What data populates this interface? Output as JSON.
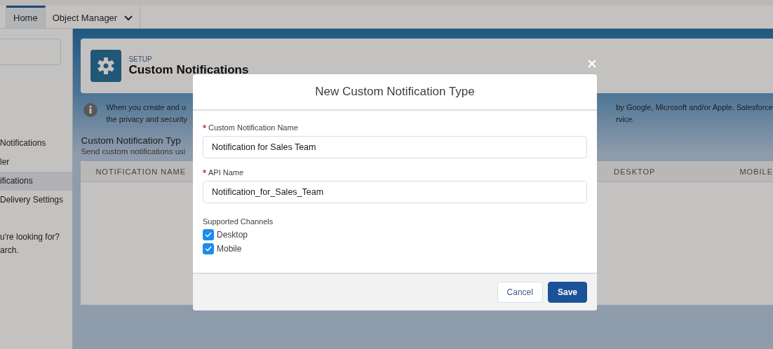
{
  "tabs": [
    {
      "label": "Home",
      "selected": true,
      "dropdown": false
    },
    {
      "label": "Object Manager",
      "selected": false,
      "dropdown": true
    }
  ],
  "sidebar": {
    "items": [
      {
        "label": "Notifications",
        "selected": false
      },
      {
        "label": "ler",
        "selected": false
      },
      {
        "label": "ifications",
        "selected": true
      },
      {
        "label": "Delivery Settings",
        "selected": false
      }
    ],
    "help_lines": [
      "u're looking for?",
      "arch."
    ]
  },
  "header": {
    "eyebrow": "SETUP",
    "title": "Custom Notifications"
  },
  "info": {
    "left_lines": [
      "When you create and u",
      "the privacy and security"
    ],
    "right_lines": [
      "by Google, Microsoft and/or Apple. Salesforce",
      "rvice."
    ]
  },
  "section": {
    "title": "Custom Notification Typ",
    "subtitle": "Send custom notifications usi"
  },
  "table": {
    "columns": [
      "NOTIFICATION NAME",
      "DESKTOP",
      "MOBILE"
    ]
  },
  "modal": {
    "title": "New Custom Notification Type",
    "fields": [
      {
        "label": "Custom Notification Name",
        "required": true,
        "value": "Notification for Sales Team"
      },
      {
        "label": "API Name",
        "required": true,
        "value": "Notification_for_Sales_Team"
      }
    ],
    "channels": {
      "label": "Supported Channels",
      "options": [
        {
          "label": "Desktop",
          "checked": true
        },
        {
          "label": "Mobile",
          "checked": true
        }
      ]
    },
    "buttons": [
      {
        "label": "Cancel",
        "kind": "neutral"
      },
      {
        "label": "Save",
        "kind": "brand"
      }
    ]
  }
}
